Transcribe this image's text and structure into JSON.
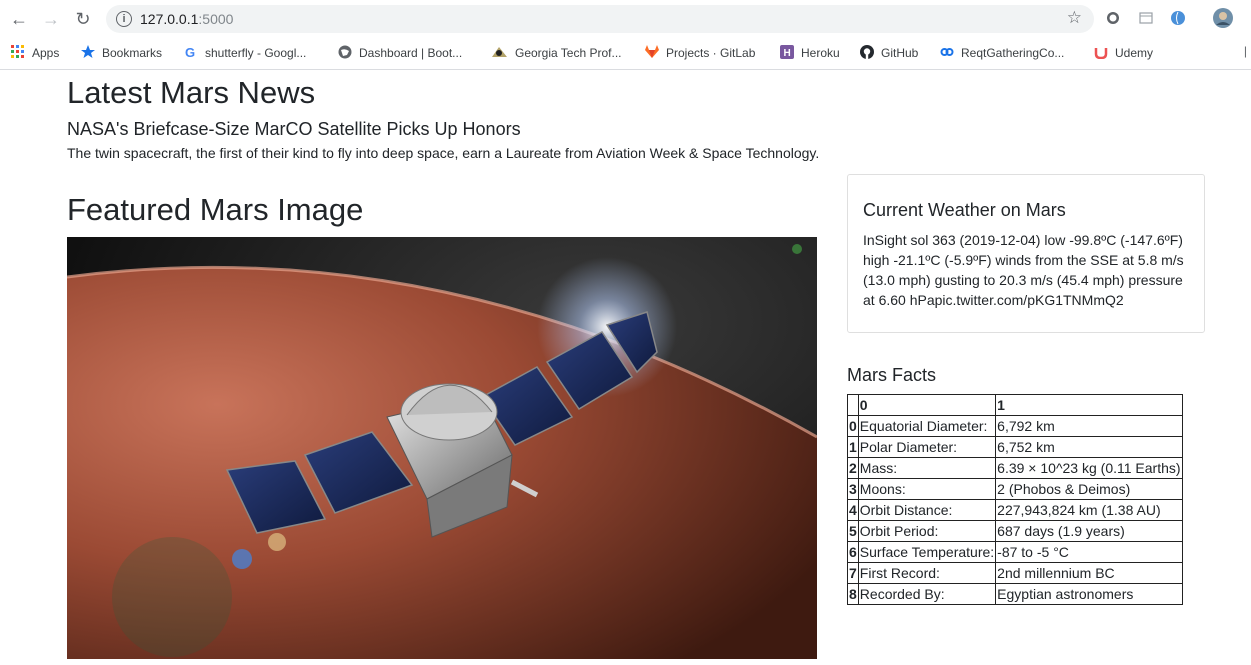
{
  "browser": {
    "url_host": "127.0.0.1",
    "url_port": ":5000",
    "bookmarks": [
      {
        "label": "Apps",
        "icon": "apps-grid-icon",
        "color": "#ea4335"
      },
      {
        "label": "Bookmarks",
        "icon": "star-icon",
        "color": "#1a73e8"
      },
      {
        "label": "shutterfly - Googl...",
        "icon": "google-icon",
        "color": "#4285f4"
      },
      {
        "label": "Dashboard | Boot...",
        "icon": "globe-icon",
        "color": "#5f6368"
      },
      {
        "label": "Georgia Tech Prof...",
        "icon": "gt-icon",
        "color": "#b3a369"
      },
      {
        "label": "Projects · GitLab",
        "icon": "gitlab-icon",
        "color": "#fc6d26"
      },
      {
        "label": "Heroku",
        "icon": "heroku-icon",
        "color": "#79589f"
      },
      {
        "label": "GitHub",
        "icon": "github-icon",
        "color": "#24292e"
      },
      {
        "label": "ReqtGatheringCo...",
        "icon": "link-icon",
        "color": "#1a73e8"
      },
      {
        "label": "Udemy",
        "icon": "udemy-icon",
        "color": "#ec5252"
      }
    ]
  },
  "news": {
    "heading": "Latest Mars News",
    "title": "NASA's Briefcase-Size MarCO Satellite Picks Up Honors",
    "teaser": "The twin spacecraft, the first of their kind to fly into deep space, earn a Laureate from Aviation Week & Space Technology."
  },
  "featured": {
    "heading": "Featured Mars Image"
  },
  "weather": {
    "heading": "Current Weather on Mars",
    "text": "InSight sol 363 (2019-12-04) low -99.8ºC (-147.6ºF) high -21.1ºC (-5.9ºF) winds from the SSE at 5.8 m/s (13.0 mph) gusting to 20.3 m/s (45.4 mph) pressure at 6.60 hPapic.twitter.com/pKG1TNMmQ2"
  },
  "facts": {
    "heading": "Mars Facts",
    "columns": [
      "0",
      "1"
    ],
    "rows": [
      {
        "idx": "0",
        "label": "Equatorial Diameter:",
        "value": "6,792 km"
      },
      {
        "idx": "1",
        "label": "Polar Diameter:",
        "value": "6,752 km"
      },
      {
        "idx": "2",
        "label": "Mass:",
        "value": "6.39 × 10^23 kg (0.11 Earths)"
      },
      {
        "idx": "3",
        "label": "Moons:",
        "value": "2 (Phobos & Deimos)"
      },
      {
        "idx": "4",
        "label": "Orbit Distance:",
        "value": "227,943,824 km (1.38 AU)"
      },
      {
        "idx": "5",
        "label": "Orbit Period:",
        "value": "687 days (1.9 years)"
      },
      {
        "idx": "6",
        "label": "Surface Temperature:",
        "value": "-87 to -5 °C"
      },
      {
        "idx": "7",
        "label": "First Record:",
        "value": "2nd millennium BC"
      },
      {
        "idx": "8",
        "label": "Recorded By:",
        "value": "Egyptian astronomers"
      }
    ]
  }
}
